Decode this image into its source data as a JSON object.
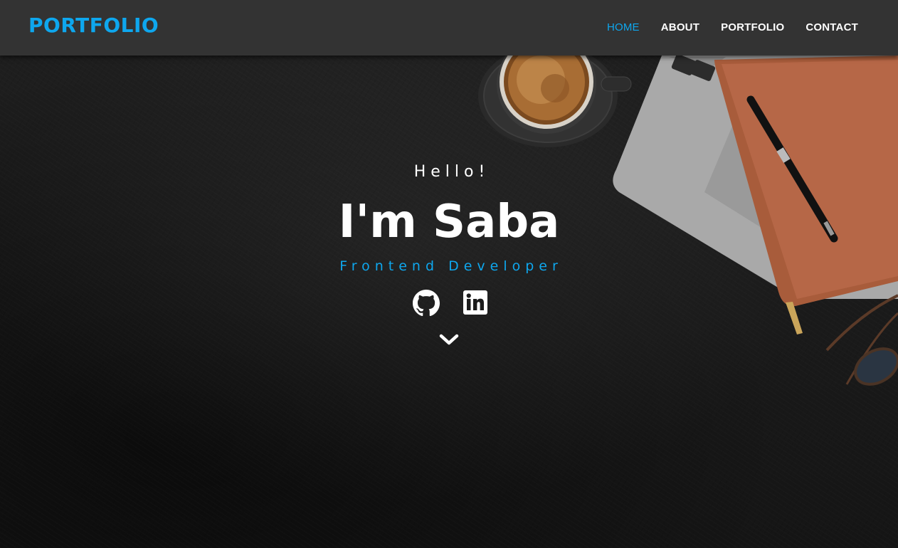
{
  "navbar": {
    "brand": "PORTFOLIO",
    "links": [
      {
        "label": "HOME",
        "active": true
      },
      {
        "label": "ABOUT",
        "active": false
      },
      {
        "label": "PORTFOLIO",
        "active": false
      },
      {
        "label": "CONTACT",
        "active": false
      }
    ]
  },
  "hero": {
    "greeting": "Hello!",
    "headline": "I'm Saba",
    "role": "Frontend Developer",
    "social_icons": [
      "github-icon",
      "linkedin-icon"
    ],
    "scroll_icon": "chevron-down-icon",
    "background_image": "dark desk with coffee cup, laptop, notebook, pen and glasses"
  },
  "colors": {
    "accent": "#0ea7ee",
    "navbar_bg": "#333333",
    "text": "#ffffff",
    "hero_bg": "#1b1b1b"
  }
}
